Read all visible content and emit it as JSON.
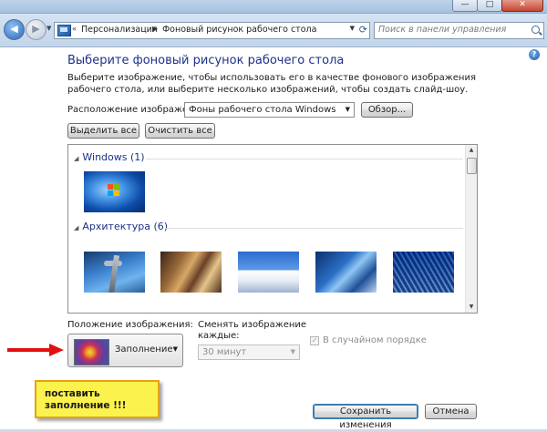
{
  "window": {
    "minimize_glyph": "—",
    "maximize_glyph": "□",
    "close_glyph": "✕"
  },
  "addressbar": {
    "back_glyph": "◀",
    "forward_glyph": "▶",
    "breadcrumb": [
      "Персонализация",
      "Фоновый рисунок рабочего стола"
    ],
    "prefix_glyph": "«",
    "separator_glyph": "▶",
    "search_placeholder": "Поиск в панели управления"
  },
  "page": {
    "title": "Выберите фоновый рисунок рабочего стола",
    "description": "Выберите изображение, чтобы использовать его в качестве фонового изображения рабочего стола, или выберите несколько изображений, чтобы создать слайд-шоу.",
    "location_label": "Расположение изображения:",
    "location_value": "Фоны рабочего стола Windows",
    "browse_label": "Обзор...",
    "select_all_label": "Выделить все",
    "clear_all_label": "Очистить все",
    "help_glyph": "?"
  },
  "gallery": {
    "groups": [
      {
        "name": "Windows (1)",
        "thumb_count": 1
      },
      {
        "name": "Архитектура (6)",
        "thumb_count": 5
      }
    ]
  },
  "position": {
    "label": "Положение изображения:",
    "value": "Заполнение"
  },
  "slideshow": {
    "change_label": "Сменять изображение каждые:",
    "interval_value": "30 минут",
    "shuffle_label": "В случайном порядке",
    "shuffle_checked": true
  },
  "annotation": {
    "note_text": "поставить заполнение !!!",
    "color": "#e21010"
  },
  "footer": {
    "save_label": "Сохранить изменения",
    "cancel_label": "Отмена"
  }
}
